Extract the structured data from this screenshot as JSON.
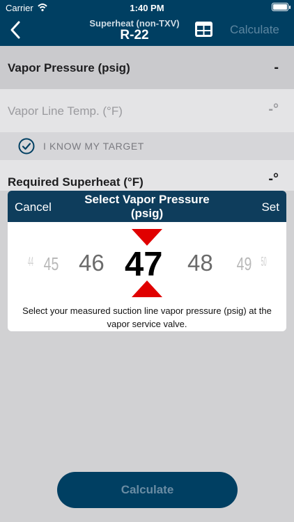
{
  "status_bar": {
    "carrier": "Carrier",
    "time": "1:40 PM"
  },
  "nav": {
    "subtitle": "Superheat (non-TXV)",
    "title": "R-22",
    "calculate_label": "Calculate"
  },
  "rows": {
    "vapor_pressure": {
      "label": "Vapor Pressure (psig)",
      "value": "-"
    },
    "vapor_line_temp": {
      "label": "Vapor Line Temp. (°F)",
      "value": "-°"
    },
    "target": {
      "label": "I KNOW MY TARGET",
      "checked": true
    },
    "required_superheat": {
      "label": "Required Superheat (°F)",
      "value": "-°"
    }
  },
  "picker": {
    "cancel": "Cancel",
    "title": "Select Vapor Pressure (psig)",
    "set": "Set",
    "numbers": [
      "44",
      "45",
      "46",
      "47",
      "48",
      "49",
      "50"
    ],
    "selected": "47",
    "description": "Select your measured suction line vapor pressure (psig) at the vapor service valve."
  },
  "bottom_button": "Calculate",
  "colors": {
    "navy": "#003f62",
    "picker_red": "#e00000"
  }
}
